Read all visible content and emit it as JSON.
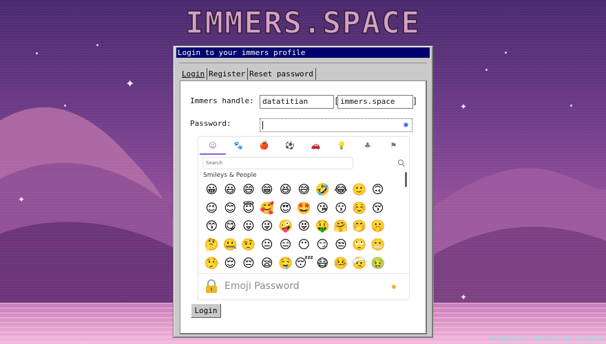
{
  "site": {
    "logo_text": "IMMERS.SPACE",
    "background_credit": "Background: Vectors by Vecteezy"
  },
  "window": {
    "title": "Login to your immers profile"
  },
  "tabs": [
    {
      "label": "Login",
      "active": true
    },
    {
      "label": "Register",
      "active": false
    },
    {
      "label": "Reset password",
      "active": false
    }
  ],
  "form": {
    "handle_label": "Immers handle:",
    "handle_value": "datatitian",
    "domain_value": "immers.space",
    "password_label": "Password:",
    "password_value": "",
    "login_button": "Login"
  },
  "emoji_picker": {
    "categories": [
      "smileys-icon",
      "animals-icon",
      "food-icon",
      "activities-icon",
      "travel-icon",
      "objects-icon",
      "symbols-icon",
      "flags-icon"
    ],
    "active_category": "smileys-icon",
    "search_placeholder": "Search",
    "section_title": "Smileys & People",
    "footer_label": "Emoji Password",
    "emoji_rows": [
      [
        "😀",
        "😃",
        "😄",
        "😁",
        "😆",
        "😅",
        "🤣",
        "😂",
        "🙂",
        "🙃"
      ],
      [
        "😉",
        "😊",
        "😇",
        "🥰",
        "😍",
        "🤩",
        "😘",
        "😗",
        "☺️",
        "😚"
      ],
      [
        "😙",
        "😋",
        "😛",
        "😜",
        "🤪",
        "😝",
        "🤑",
        "🤗",
        "🤭",
        "🤫"
      ],
      [
        "🤔",
        "🤐",
        "🤨",
        "😐",
        "😑",
        "😶",
        "😏",
        "😒",
        "🙄",
        "😬"
      ],
      [
        "🤥",
        "😌",
        "😔",
        "😪",
        "🤤",
        "😴",
        "😷",
        "🤒",
        "🤕",
        "🤢"
      ]
    ]
  },
  "colors": {
    "titlebar": "#00006e",
    "accent": "#8a5fd0",
    "window": "#c9c9c9"
  }
}
